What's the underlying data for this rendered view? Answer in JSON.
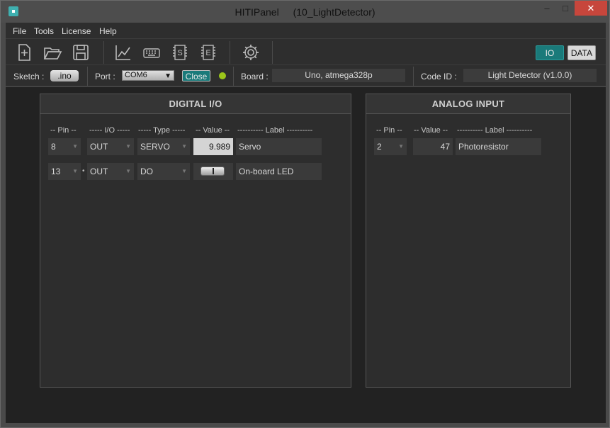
{
  "window": {
    "app_name": "HITIPanel",
    "document": "(10_LightDetector)",
    "minimize": "–",
    "maximize": "□",
    "close": "✕"
  },
  "menu": {
    "items": [
      "File",
      "Tools",
      "License",
      "Help"
    ]
  },
  "toolbar": {
    "icons": [
      "new-file-icon",
      "open-folder-icon",
      "save-icon",
      "chart-icon",
      "keyboard-icon",
      "serial-s-icon",
      "eeprom-e-icon",
      "settings-gear-icon"
    ],
    "io_label": "IO",
    "data_label": "DATA",
    "io_color": "#1a7a7a"
  },
  "status": {
    "sketch_label": "Sketch :",
    "sketch_button": ".ino",
    "port_label": "Port :",
    "port_value": "COM6",
    "close_button": "Close",
    "led_color": "#9cc61a",
    "board_label": "Board :",
    "board_value": "Uno, atmega328p",
    "codeid_label": "Code ID :",
    "codeid_value": "Light Detector  (v1.0.0)"
  },
  "digital": {
    "title": "DIGITAL  I/O",
    "headers": {
      "pin": "-- Pin --",
      "io": "----- I/O -----",
      "type": "----- Type -----",
      "value": "-- Value --",
      "label": "---------- Label ----------"
    },
    "rows": [
      {
        "pin": "8",
        "io": "OUT",
        "type": "SERVO",
        "value": "9.989",
        "label": "Servo"
      },
      {
        "pin": "13",
        "io": "OUT",
        "type": "DO",
        "value": "",
        "label": "On-board LED"
      }
    ]
  },
  "analog": {
    "title": "ANALOG  INPUT",
    "headers": {
      "pin": "-- Pin --",
      "value": "-- Value --",
      "label": "---------- Label ----------"
    },
    "rows": [
      {
        "pin": "2",
        "value": "47",
        "label": "Photoresistor"
      }
    ]
  }
}
